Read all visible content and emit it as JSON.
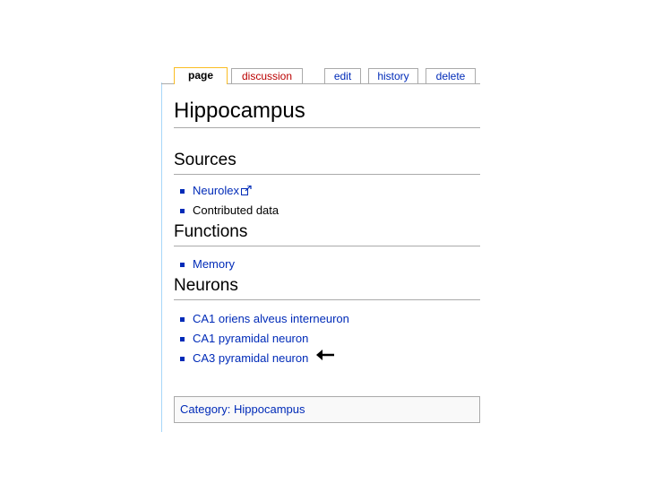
{
  "tabs": {
    "page": "page",
    "discussion": "discussion",
    "edit": "edit",
    "history": "history",
    "delete": "delete"
  },
  "page_title": "Hippocampus",
  "sections": {
    "sources": {
      "heading": "Sources",
      "items": [
        "Neurolex",
        "Contributed data"
      ]
    },
    "functions": {
      "heading": "Functions",
      "items": [
        "Memory"
      ]
    },
    "neurons": {
      "heading": "Neurons",
      "items": [
        "CA1 oriens alveus interneuron",
        "CA1 pyramidal neuron",
        "CA3 pyramidal neuron"
      ]
    }
  },
  "category": {
    "label": "Category:",
    "value": "Hippocampus"
  },
  "colors": {
    "link": "#002bb8",
    "new_link": "#ba0000",
    "selected_tab_border": "#fabd23",
    "border": "#aaaaaa"
  },
  "icons": {
    "external_link": "external-link-icon",
    "arrow": "left-arrow-icon"
  }
}
